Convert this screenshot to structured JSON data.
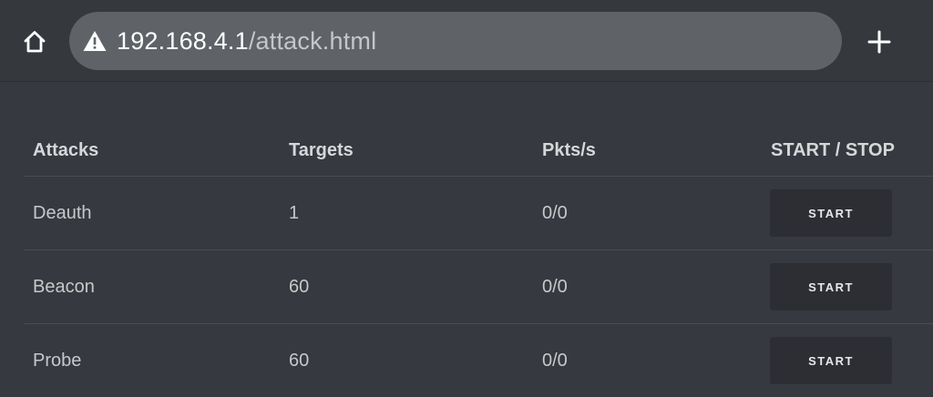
{
  "browser": {
    "home_icon": "home-icon",
    "warning_icon": "warning-icon",
    "url_host": "192.168.4.1",
    "url_path": "/attack.html",
    "new_tab_icon": "plus-icon"
  },
  "table": {
    "headers": [
      "Attacks",
      "Targets",
      "Pkts/s",
      "START / STOP"
    ],
    "rows": [
      {
        "attack": "Deauth",
        "targets": "1",
        "pkts": "0/0",
        "button": "START"
      },
      {
        "attack": "Beacon",
        "targets": "60",
        "pkts": "0/0",
        "button": "START"
      },
      {
        "attack": "Probe",
        "targets": "60",
        "pkts": "0/0",
        "button": "START"
      }
    ]
  },
  "colors": {
    "background": "#36393f",
    "url_bar": "#5f6368",
    "button": "#2c2e33"
  }
}
